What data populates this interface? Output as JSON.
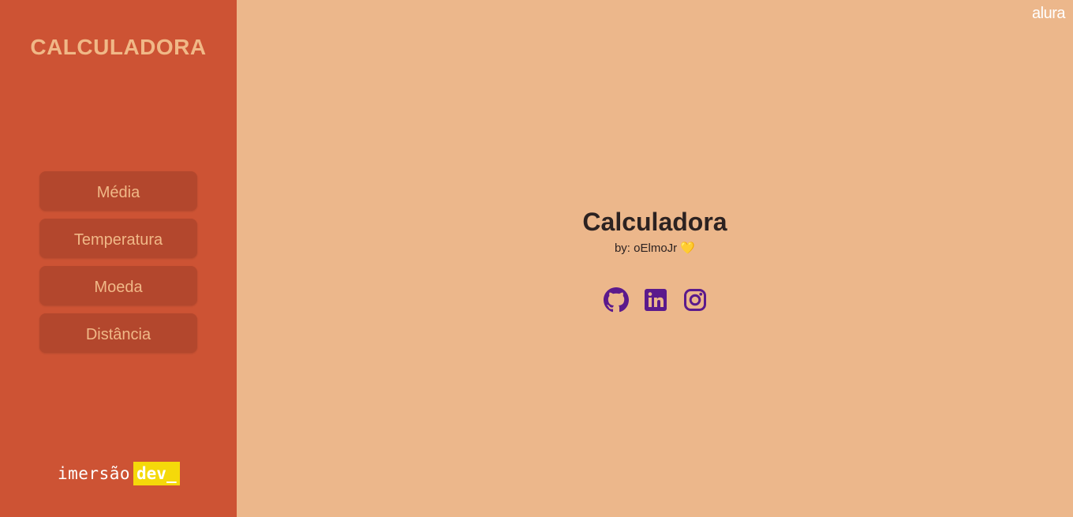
{
  "sidebar": {
    "title": "CALCULADORA",
    "menu": [
      {
        "label": "Média"
      },
      {
        "label": "Temperatura"
      },
      {
        "label": "Moeda"
      },
      {
        "label": "Distância"
      }
    ],
    "brand": {
      "part1": "imersão",
      "part2": "dev_"
    }
  },
  "header": {
    "logo": "alura"
  },
  "main": {
    "title": "Calculadora",
    "byline": "by: oElmoJr",
    "heart": "💛",
    "socials": [
      {
        "icon": "github-icon"
      },
      {
        "icon": "linkedin-icon"
      },
      {
        "icon": "instagram-icon"
      }
    ]
  },
  "colors": {
    "sidebar_bg": "#cd5334",
    "main_bg": "#ecb78b",
    "button_bg": "#b3472d",
    "accent_text": "#f0b887",
    "icon_color": "#5b1a8c",
    "brand_yellow": "#f5d90a"
  }
}
